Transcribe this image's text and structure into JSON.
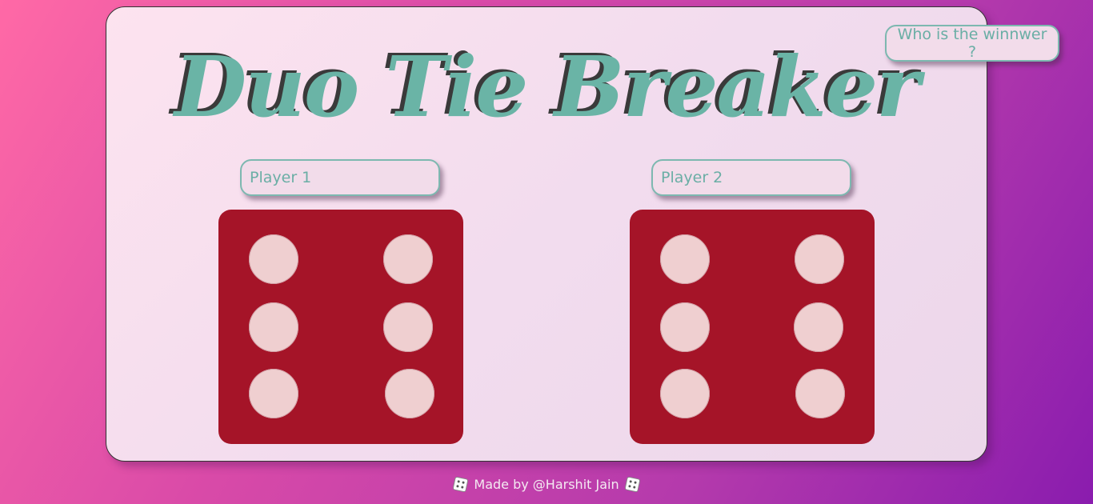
{
  "app": {
    "title": "Duo Tie Breaker",
    "winner_button_label": "Who is the winnwer ?"
  },
  "players": [
    {
      "placeholder": "Player 1",
      "die_value": 6
    },
    {
      "placeholder": "Player 2",
      "die_value": 6
    }
  ],
  "footer": {
    "text": "Made by @Harshit Jain",
    "leading_icon": "dice-icon",
    "trailing_icon": "dice-icon"
  },
  "colors": {
    "title": "#6ab4a6",
    "die_face": "#a51428",
    "pip": "#efcfd0",
    "accent": "#7db8b0"
  }
}
